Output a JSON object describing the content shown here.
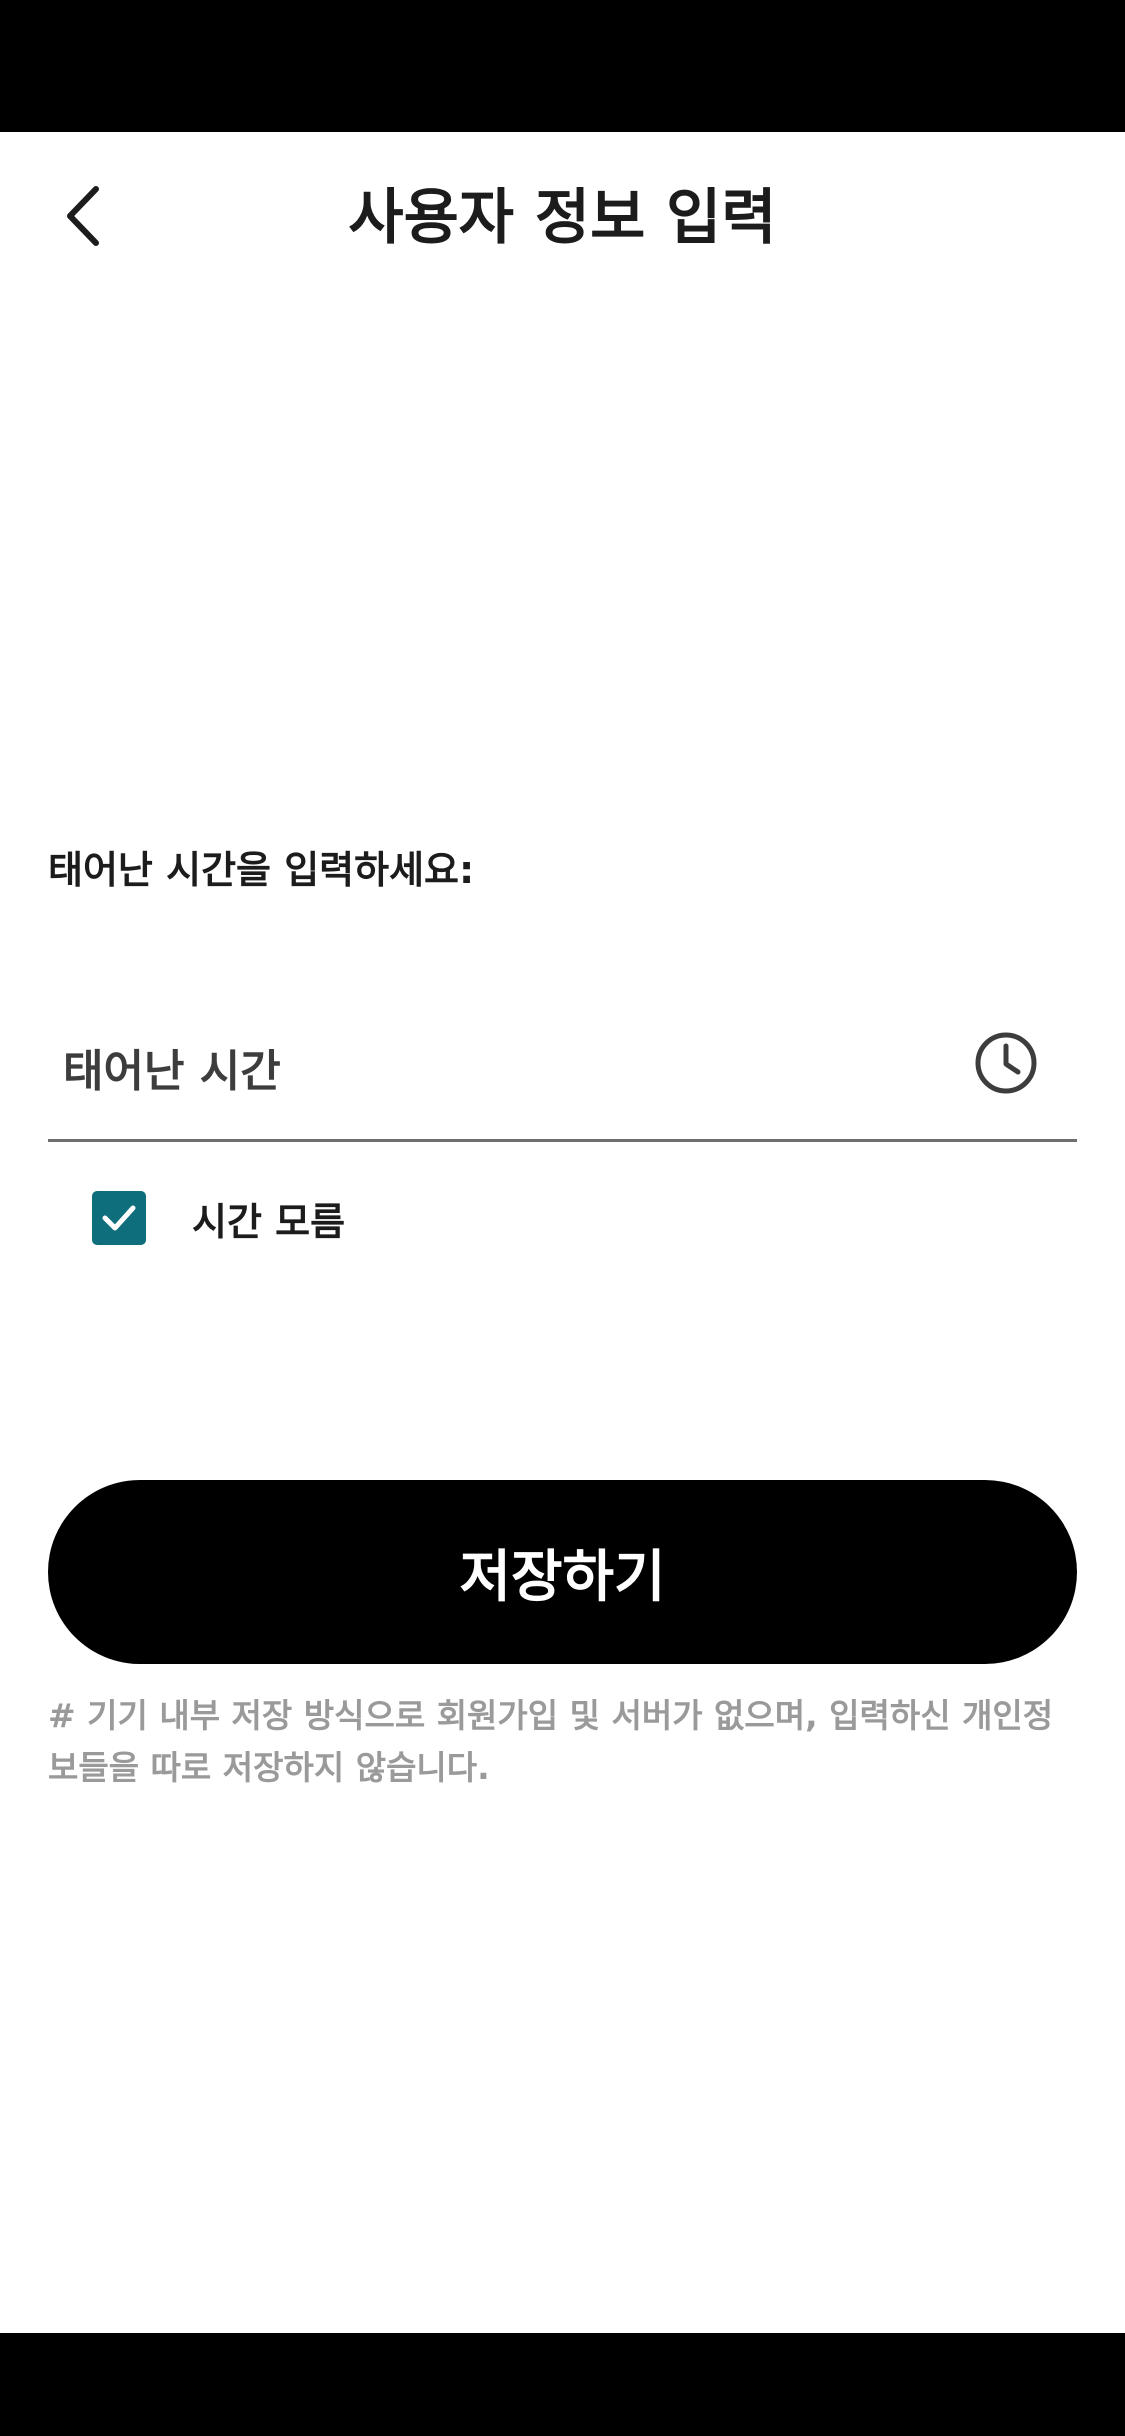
{
  "header": {
    "title": "사용자 정보 입력",
    "back_icon": "chevron-left-icon"
  },
  "form": {
    "prompt": "태어난 시간을 입력하세요:",
    "time_field": {
      "placeholder": "태어난 시간",
      "icon": "clock-icon"
    },
    "unknown_time": {
      "label": "시간 모름",
      "checked": true
    },
    "save_label": "저장하기",
    "notice": "# 기기 내부 저장 방식으로 회원가입 및 서버가 없으며, 입력하신 개인정보들을 따로 저장하지 않습니다."
  },
  "colors": {
    "accent": "#0f6e7c",
    "button": "#000000",
    "notice_text": "#9a9a9a"
  }
}
